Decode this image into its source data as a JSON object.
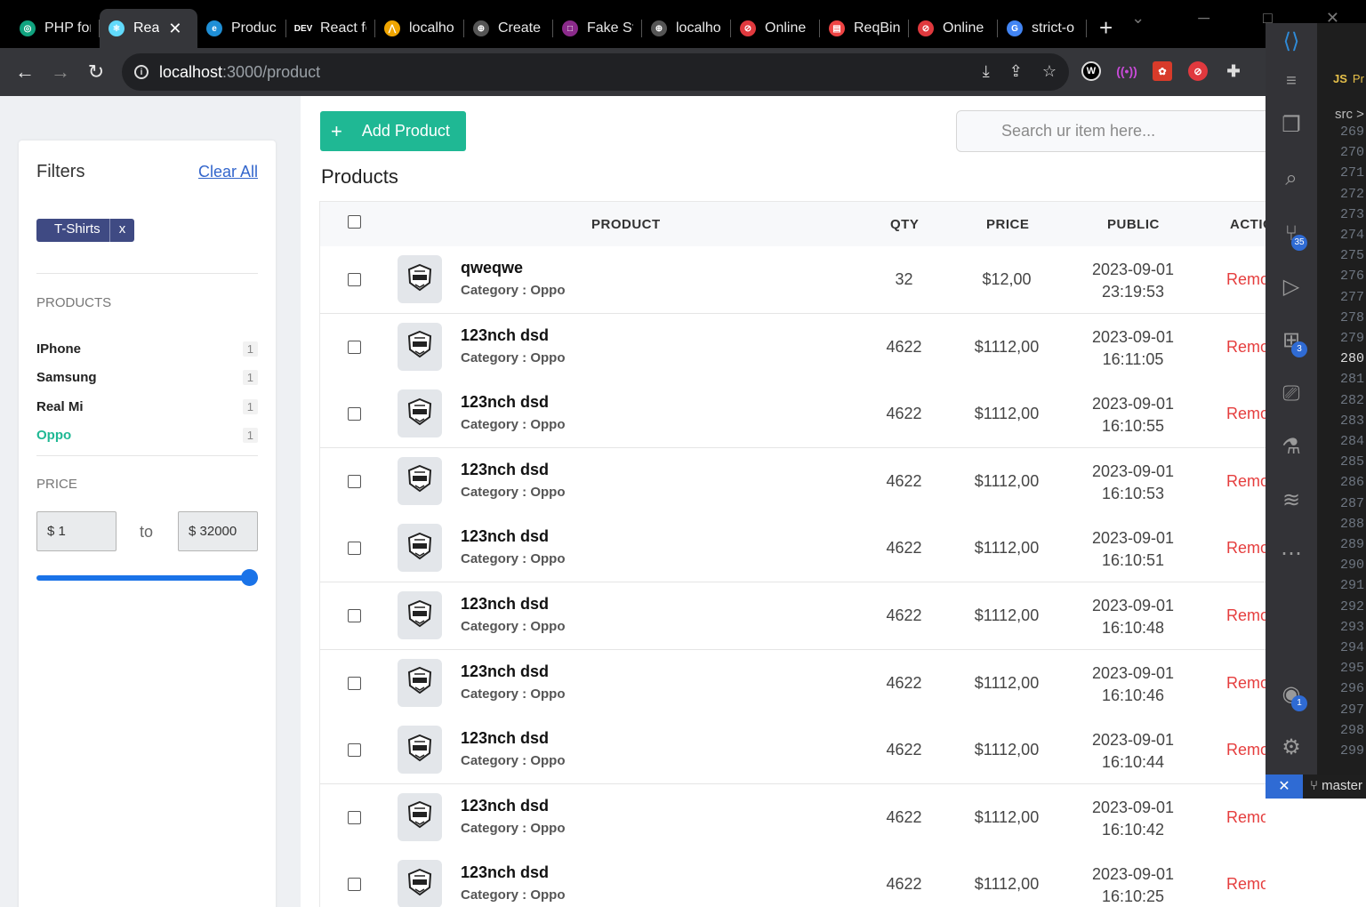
{
  "browser": {
    "tabs": [
      {
        "label": "PHP for",
        "icon": "chatgpt-icon",
        "color": "#10a37f",
        "glyph": "◎"
      },
      {
        "label": "Rea",
        "icon": "react-icon",
        "color": "#61dafb",
        "glyph": "⚛",
        "active": true
      },
      {
        "label": "Produc",
        "icon": "edge-icon",
        "color": "#1f8fd6",
        "glyph": "e"
      },
      {
        "label": "React fo",
        "icon": "dev-icon",
        "color": "#000000",
        "glyph": "DEV"
      },
      {
        "label": "localho",
        "icon": "xampp-icon",
        "color": "#f0a500",
        "glyph": "⋀"
      },
      {
        "label": "Create",
        "icon": "globe-icon",
        "color": "#555555",
        "glyph": "⊕"
      },
      {
        "label": "Fake St",
        "icon": "fakestore-icon",
        "color": "#8b2a8b",
        "glyph": "□"
      },
      {
        "label": "localho",
        "icon": "globe-icon",
        "color": "#555555",
        "glyph": "⊕"
      },
      {
        "label": "Online",
        "icon": "online-icon",
        "color": "#e0393e",
        "glyph": "⊘"
      },
      {
        "label": "ReqBin",
        "icon": "reqbin-icon",
        "color": "#e44",
        "glyph": "▤"
      },
      {
        "label": "Online",
        "icon": "online-icon",
        "color": "#e0393e",
        "glyph": "⊘"
      },
      {
        "label": "strict-o",
        "icon": "google-icon",
        "color": "#4285f4",
        "glyph": "G"
      }
    ],
    "url_host": "localhost",
    "url_path": ":3000/product"
  },
  "sidebar": {
    "title": "Filters",
    "clear_all": "Clear All",
    "chip_label": "T-Shirts",
    "chip_remove": "x",
    "products_heading": "PRODUCTS",
    "brands": [
      {
        "name": "IPhone",
        "count": "1"
      },
      {
        "name": "Samsung",
        "count": "1"
      },
      {
        "name": "Real Mi",
        "count": "1"
      },
      {
        "name": "Oppo",
        "count": "1",
        "selected": true
      }
    ],
    "price_heading": "PRICE",
    "price_min": "$ 1",
    "price_to": "to",
    "price_max": "$ 32000"
  },
  "main": {
    "add_button": "Add Product",
    "search_placeholder": "Search ur item here...",
    "title": "Products",
    "columns": [
      "PRODUCT",
      "QTY",
      "PRICE",
      "PUBLIC",
      "ACTIO"
    ],
    "rows": [
      {
        "name": "qweqwe",
        "category": "Category : Oppo",
        "qty": "32",
        "price": "$12,00",
        "date": "2023-09-01",
        "time": "23:19:53",
        "action": "Remove"
      },
      {
        "name": "123nch dsd",
        "category": "Category : Oppo",
        "qty": "4622",
        "price": "$1112,00",
        "date": "2023-09-01",
        "time": "16:11:05",
        "action": "Remove"
      },
      {
        "name": "123nch dsd",
        "category": "Category : Oppo",
        "qty": "4622",
        "price": "$1112,00",
        "date": "2023-09-01",
        "time": "16:10:55",
        "action": "Remove"
      },
      {
        "name": "123nch dsd",
        "category": "Category : Oppo",
        "qty": "4622",
        "price": "$1112,00",
        "date": "2023-09-01",
        "time": "16:10:53",
        "action": "Remove"
      },
      {
        "name": "123nch dsd",
        "category": "Category : Oppo",
        "qty": "4622",
        "price": "$1112,00",
        "date": "2023-09-01",
        "time": "16:10:51",
        "action": "Remove"
      },
      {
        "name": "123nch dsd",
        "category": "Category : Oppo",
        "qty": "4622",
        "price": "$1112,00",
        "date": "2023-09-01",
        "time": "16:10:48",
        "action": "Remove"
      },
      {
        "name": "123nch dsd",
        "category": "Category : Oppo",
        "qty": "4622",
        "price": "$1112,00",
        "date": "2023-09-01",
        "time": "16:10:46",
        "action": "Remove"
      },
      {
        "name": "123nch dsd",
        "category": "Category : Oppo",
        "qty": "4622",
        "price": "$1112,00",
        "date": "2023-09-01",
        "time": "16:10:44",
        "action": "Remove"
      },
      {
        "name": "123nch dsd",
        "category": "Category : Oppo",
        "qty": "4622",
        "price": "$1112,00",
        "date": "2023-09-01",
        "time": "16:10:42",
        "action": "Remove"
      },
      {
        "name": "123nch dsd",
        "category": "Category : Oppo",
        "qty": "4622",
        "price": "$1112,00",
        "date": "2023-09-01",
        "time": "16:10:25",
        "action": "Remove"
      }
    ]
  },
  "vscode": {
    "tab_prefix": "JS",
    "tab_label": "Pr",
    "breadcrumb": "src >",
    "line_numbers": [
      "269",
      "270",
      "271",
      "272",
      "273",
      "274",
      "275",
      "276",
      "277",
      "278",
      "279",
      "280",
      "281",
      "282",
      "283",
      "284",
      "285",
      "286",
      "287",
      "288",
      "289",
      "290",
      "291",
      "292",
      "293",
      "294",
      "295",
      "296",
      "297",
      "298",
      "299"
    ],
    "current_line": "280",
    "badges": {
      "source_control": "35",
      "extensions": "3",
      "accounts": "1"
    },
    "branch": "master"
  },
  "colors": {
    "accent": "#1fb894",
    "chip": "#3f4a83",
    "remove": "#e53e3e",
    "vscode_blue": "#2f6bd4"
  }
}
